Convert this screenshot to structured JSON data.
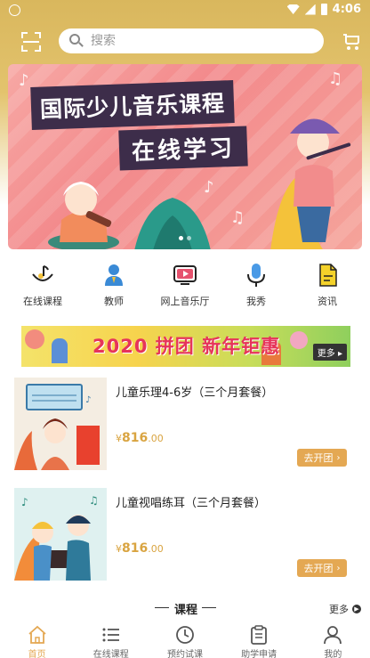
{
  "status_bar": {
    "time": "4:06"
  },
  "header": {
    "search_placeholder": "搜索"
  },
  "banner": {
    "title": "国际少儿音乐课程",
    "subtitle": "在线学习"
  },
  "quick_nav": [
    {
      "label": "在线课程",
      "icon": "music-note-icon"
    },
    {
      "label": "教师",
      "icon": "teacher-icon"
    },
    {
      "label": "网上音乐厅",
      "icon": "video-play-icon"
    },
    {
      "label": "我秀",
      "icon": "microphone-icon"
    },
    {
      "label": "资讯",
      "icon": "news-icon"
    }
  ],
  "promo": {
    "text": "2020 拼团 新年钜惠",
    "more": "更多"
  },
  "courses": [
    {
      "title": "儿童乐理4-6岁（三个月套餐）",
      "currency": "¥",
      "price_int": "816",
      "price_dec": ".00",
      "button": "去开团"
    },
    {
      "title": "儿童视唱练耳（三个月套餐）",
      "currency": "¥",
      "price_int": "816",
      "price_dec": ".00",
      "button": "去开团"
    }
  ],
  "section": {
    "title": "课程",
    "more": "更多"
  },
  "bottom_nav": [
    {
      "label": "首页",
      "active": true
    },
    {
      "label": "在线课程",
      "active": false
    },
    {
      "label": "预约试课",
      "active": false
    },
    {
      "label": "助学申请",
      "active": false
    },
    {
      "label": "我的",
      "active": false
    }
  ],
  "colors": {
    "accent": "#e4a853",
    "header": "#d9b75d",
    "promo_text": "#e6345a",
    "banner_box": "#3d2d4a"
  }
}
